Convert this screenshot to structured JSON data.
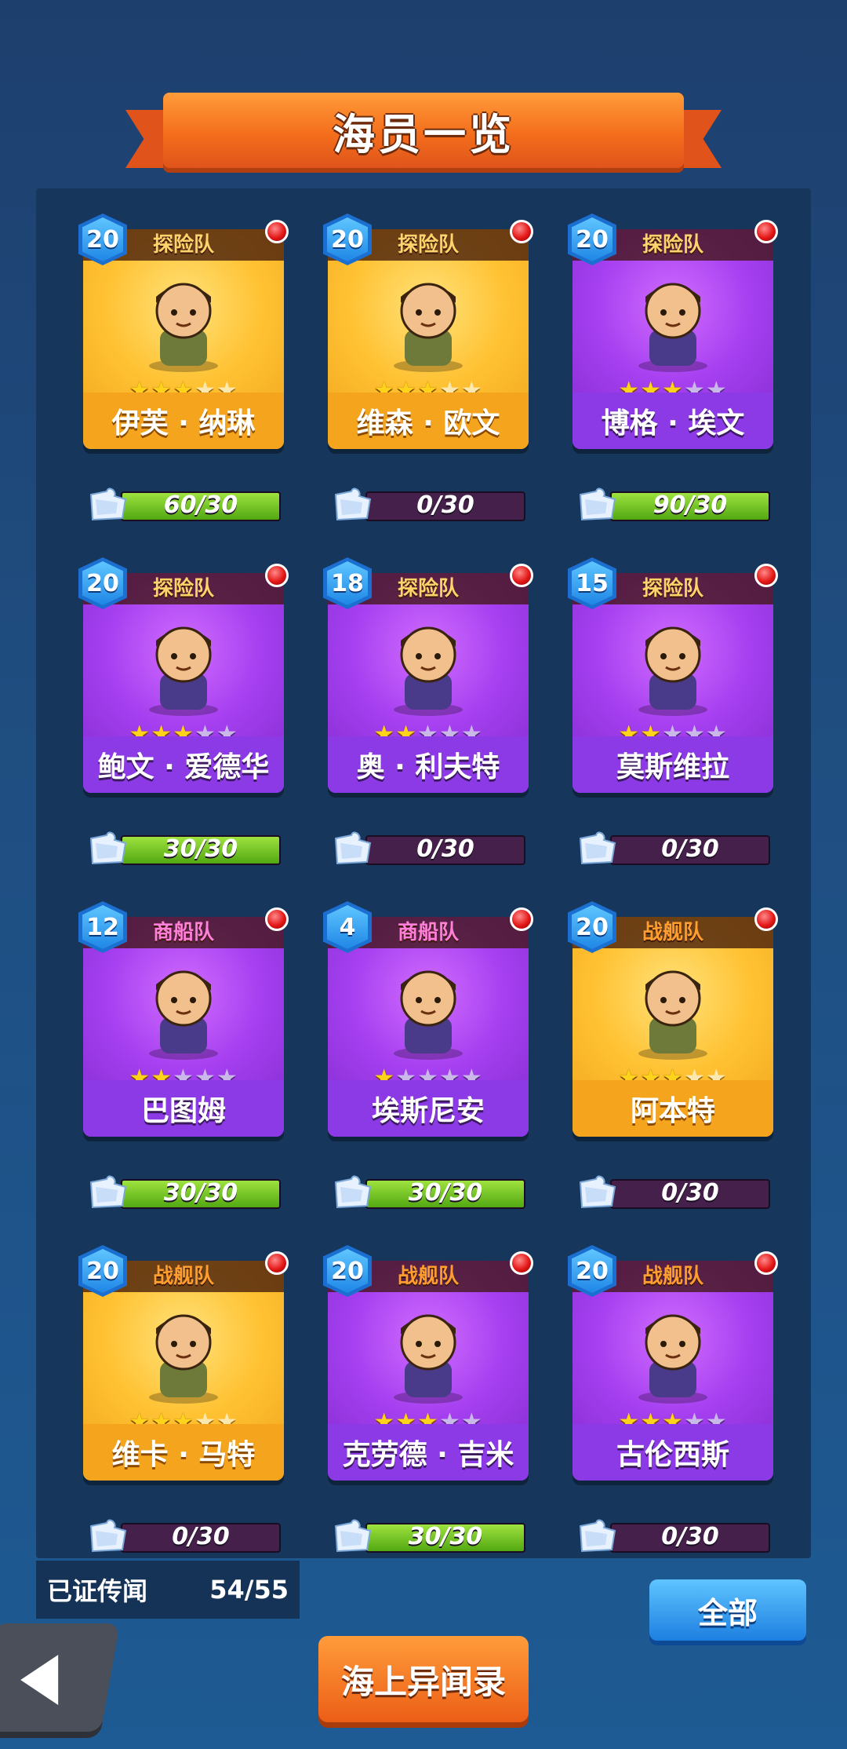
{
  "title": "海员一览",
  "collected": {
    "label": "已证传闻",
    "value": "54/55"
  },
  "buttons": {
    "all": "全部",
    "sea_log": "海上异闻录"
  },
  "colors": {
    "gold_card": "#ffc233",
    "purple_card": "#a53ff0",
    "progress_green": "#52a812",
    "alert_red": "#e41818"
  },
  "crew": [
    {
      "level": "20",
      "team": "探险队",
      "team_type": "explorer",
      "rarity": "gold",
      "name": "伊芙 · 纳琳",
      "stars": 3,
      "progress_text": "60/30",
      "progress": 1.0
    },
    {
      "level": "20",
      "team": "探险队",
      "team_type": "explorer",
      "rarity": "gold",
      "name": "维森 · 欧文",
      "stars": 3,
      "progress_text": "0/30",
      "progress": 0
    },
    {
      "level": "20",
      "team": "探险队",
      "team_type": "explorer",
      "rarity": "purple",
      "name": "博格 · 埃文",
      "stars": 3,
      "progress_text": "90/30",
      "progress": 1.0
    },
    {
      "level": "20",
      "team": "探险队",
      "team_type": "explorer",
      "rarity": "purple",
      "name": "鲍文 · 爱德华",
      "stars": 3,
      "progress_text": "30/30",
      "progress": 1.0
    },
    {
      "level": "18",
      "team": "探险队",
      "team_type": "explorer",
      "rarity": "purple",
      "name": "奥 · 利夫特",
      "stars": 2,
      "progress_text": "0/30",
      "progress": 0
    },
    {
      "level": "15",
      "team": "探险队",
      "team_type": "explorer",
      "rarity": "purple",
      "name": "莫斯维拉",
      "stars": 2,
      "progress_text": "0/30",
      "progress": 0
    },
    {
      "level": "12",
      "team": "商船队",
      "team_type": "merchant",
      "rarity": "purple",
      "name": "巴图姆",
      "stars": 2,
      "progress_text": "30/30",
      "progress": 1.0
    },
    {
      "level": "4",
      "team": "商船队",
      "team_type": "merchant",
      "rarity": "purple",
      "name": "埃斯尼安",
      "stars": 1,
      "progress_text": "30/30",
      "progress": 1.0
    },
    {
      "level": "20",
      "team": "战舰队",
      "team_type": "warship",
      "rarity": "gold",
      "name": "阿本特",
      "stars": 3,
      "progress_text": "0/30",
      "progress": 0
    },
    {
      "level": "20",
      "team": "战舰队",
      "team_type": "warship",
      "rarity": "gold",
      "name": "维卡 · 马特",
      "stars": 3,
      "progress_text": "0/30",
      "progress": 0
    },
    {
      "level": "20",
      "team": "战舰队",
      "team_type": "warship",
      "rarity": "purple",
      "name": "克劳德 · 吉米",
      "stars": 3,
      "progress_text": "30/30",
      "progress": 1.0
    },
    {
      "level": "20",
      "team": "战舰队",
      "team_type": "warship",
      "rarity": "purple",
      "name": "古伦西斯",
      "stars": 3,
      "progress_text": "0/30",
      "progress": 0
    }
  ]
}
